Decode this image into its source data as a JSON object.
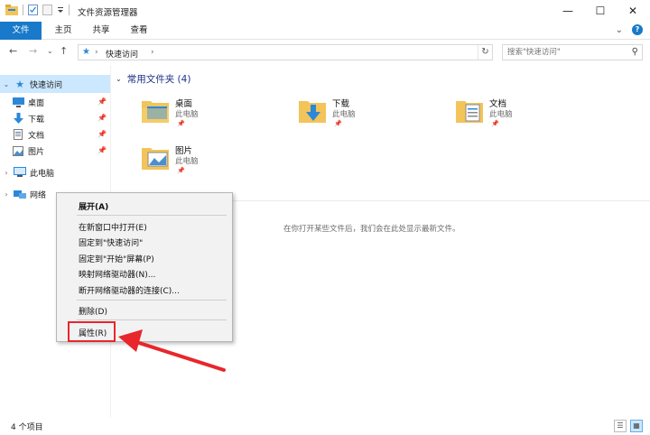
{
  "window": {
    "title": "文件资源管理器",
    "controls": {
      "minimize": "—",
      "maximize": "☐",
      "close": "✕"
    }
  },
  "ribbon": {
    "tabs": [
      {
        "label": "文件",
        "active": true
      },
      {
        "label": "主页",
        "active": false
      },
      {
        "label": "共享",
        "active": false
      },
      {
        "label": "查看",
        "active": false
      }
    ],
    "collapse": "⌄",
    "help": "?"
  },
  "nav": {
    "back": "←",
    "forward": "→",
    "recent": "⌄",
    "up": "↑",
    "breadcrumb": "快速访问",
    "refresh": "↻",
    "search_placeholder": "搜索\"快速访问\""
  },
  "sidebar": {
    "items": [
      {
        "label": "快速访问",
        "icon": "star-icon",
        "selected": true,
        "expander": "⌄"
      },
      {
        "label": "桌面",
        "icon": "desktop-icon",
        "pinned": true
      },
      {
        "label": "下载",
        "icon": "download-icon",
        "pinned": true
      },
      {
        "label": "文档",
        "icon": "document-icon",
        "pinned": true
      },
      {
        "label": "图片",
        "icon": "picture-icon",
        "pinned": true
      },
      {
        "label": "此电脑",
        "icon": "computer-icon",
        "expander": "›"
      },
      {
        "label": "网络",
        "icon": "network-icon",
        "expander": "›"
      }
    ]
  },
  "main": {
    "group_header": "常用文件夹 (4)",
    "folders": [
      {
        "name": "桌面",
        "location": "此电脑"
      },
      {
        "name": "下载",
        "location": "此电脑"
      },
      {
        "name": "文档",
        "location": "此电脑"
      },
      {
        "name": "图片",
        "location": "此电脑"
      }
    ],
    "empty_recent": "在你打开某些文件后，我们会在此处显示最新文件。"
  },
  "context_menu": {
    "items": [
      "展开(A)",
      "在新窗口中打开(E)",
      "固定到\"快速访问\"",
      "固定到\"开始\"屏幕(P)",
      "映射网络驱动器(N)...",
      "断开网络驱动器的连接(C)...",
      "删除(D)",
      "属性(R)"
    ]
  },
  "status": {
    "item_count": "4 个项目"
  },
  "colors": {
    "accent": "#1979ca",
    "selection": "#cce8ff",
    "annotation": "#e8262b",
    "folder": "#f2c45a"
  }
}
